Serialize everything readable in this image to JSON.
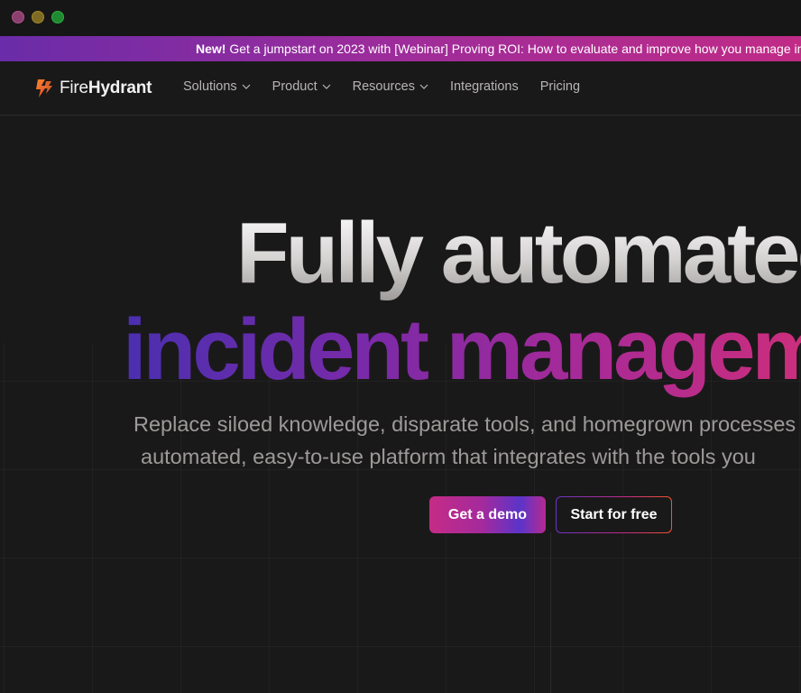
{
  "window": {
    "controls": [
      "close",
      "minimize",
      "maximize"
    ]
  },
  "banner": {
    "new_label": "New!",
    "message": " Get a jumpstart on 2023 with [Webinar] Proving ROI: How to evaluate and improve how you manage incidents"
  },
  "nav": {
    "logo": {
      "part1": "Fire",
      "part2": "Hydrant"
    },
    "items": [
      {
        "label": "Solutions",
        "dropdown": true
      },
      {
        "label": "Product",
        "dropdown": true
      },
      {
        "label": "Resources",
        "dropdown": true
      },
      {
        "label": "Integrations",
        "dropdown": false
      },
      {
        "label": "Pricing",
        "dropdown": false
      }
    ]
  },
  "hero": {
    "headline_line1": "Fully automated",
    "headline_line2": "incident management",
    "subtitle_line1": "Replace siloed knowledge, disparate tools, and homegrown processes",
    "subtitle_line2": "automated, easy-to-use platform that integrates with the tools you",
    "primary_cta": "Get a demo",
    "secondary_cta": "Start for free"
  },
  "colors": {
    "background": "#1a1919",
    "brand_orange": "#f0562e",
    "brand_pink": "#c52b86",
    "brand_purple": "#5b34c9"
  }
}
